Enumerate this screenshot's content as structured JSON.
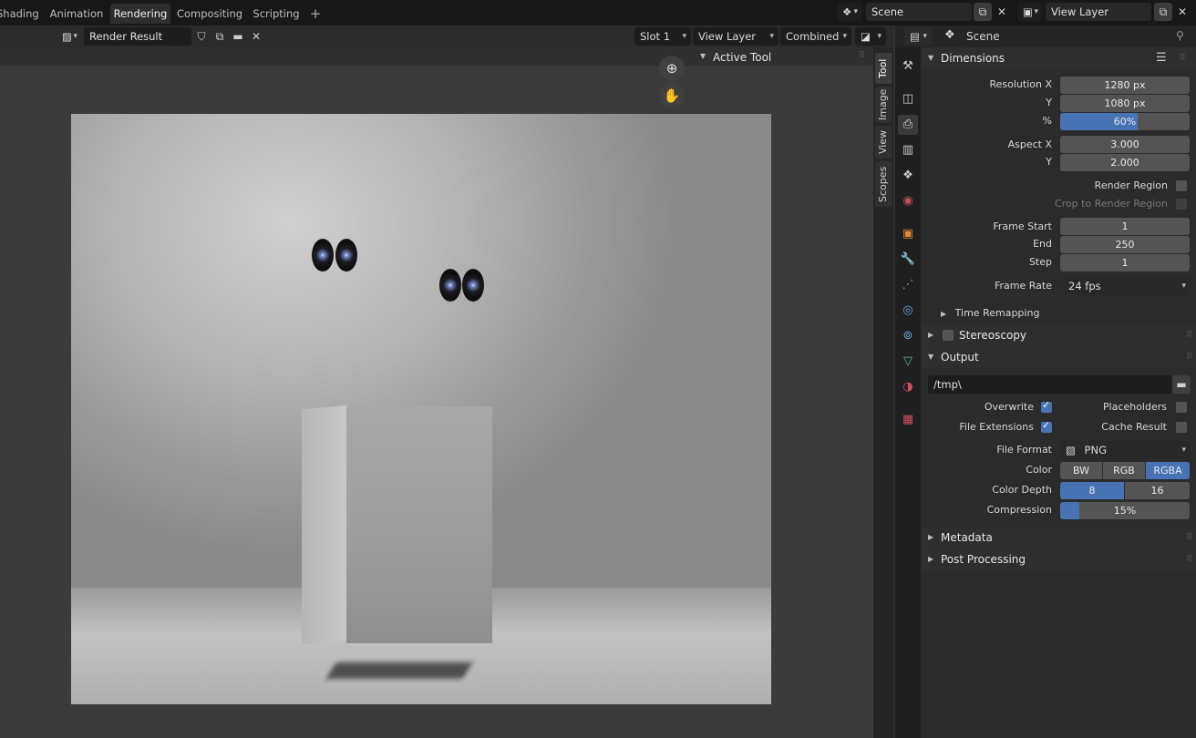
{
  "workspace_tabs": [
    "Shading",
    "Animation",
    "Rendering",
    "Compositing",
    "Scripting"
  ],
  "active_tab": "Rendering",
  "scene": {
    "name": "Scene",
    "view_layer": "View Layer"
  },
  "image_editor": {
    "image_name": "Render Result",
    "slot": "Slot 1",
    "layer": "View Layer",
    "pass": "Combined"
  },
  "sidebar": {
    "panel_title": "Active Tool",
    "tabs": [
      "Tool",
      "Image",
      "View",
      "Scopes"
    ],
    "active_tab": "Tool"
  },
  "properties": {
    "context": "Scene",
    "dimensions": {
      "title": "Dimensions",
      "resolution_x_label": "Resolution X",
      "resolution_x": "1280 px",
      "resolution_y_label": "Y",
      "resolution_y": "1080 px",
      "percent_label": "%",
      "percent": "60%",
      "percent_value": 0.6,
      "aspect_x_label": "Aspect X",
      "aspect_x": "3.000",
      "aspect_y_label": "Y",
      "aspect_y": "2.000",
      "render_region": "Render Region",
      "crop_region": "Crop to Render Region",
      "frame_start_label": "Frame Start",
      "frame_start": "1",
      "frame_end_label": "End",
      "frame_end": "250",
      "frame_step_label": "Step",
      "frame_step": "1",
      "frame_rate_label": "Frame Rate",
      "frame_rate": "24 fps",
      "time_remapping": "Time Remapping"
    },
    "stereoscopy": "Stereoscopy",
    "output": {
      "title": "Output",
      "path": "/tmp\\",
      "overwrite": "Overwrite",
      "placeholders": "Placeholders",
      "file_extensions": "File Extensions",
      "cache_result": "Cache Result",
      "file_format_label": "File Format",
      "file_format": "PNG",
      "color_label": "Color",
      "color_options": [
        "BW",
        "RGB",
        "RGBA"
      ],
      "color_selected": "RGBA",
      "color_depth_label": "Color Depth",
      "color_depth_options": [
        "8",
        "16"
      ],
      "color_depth_selected": "8",
      "compression_label": "Compression",
      "compression": "15%",
      "compression_value": 0.15
    },
    "metadata": "Metadata",
    "post_processing": "Post Processing"
  },
  "colors": {
    "accent": "#4772b3",
    "header": "#181818",
    "panel": "#2b2b2b"
  }
}
